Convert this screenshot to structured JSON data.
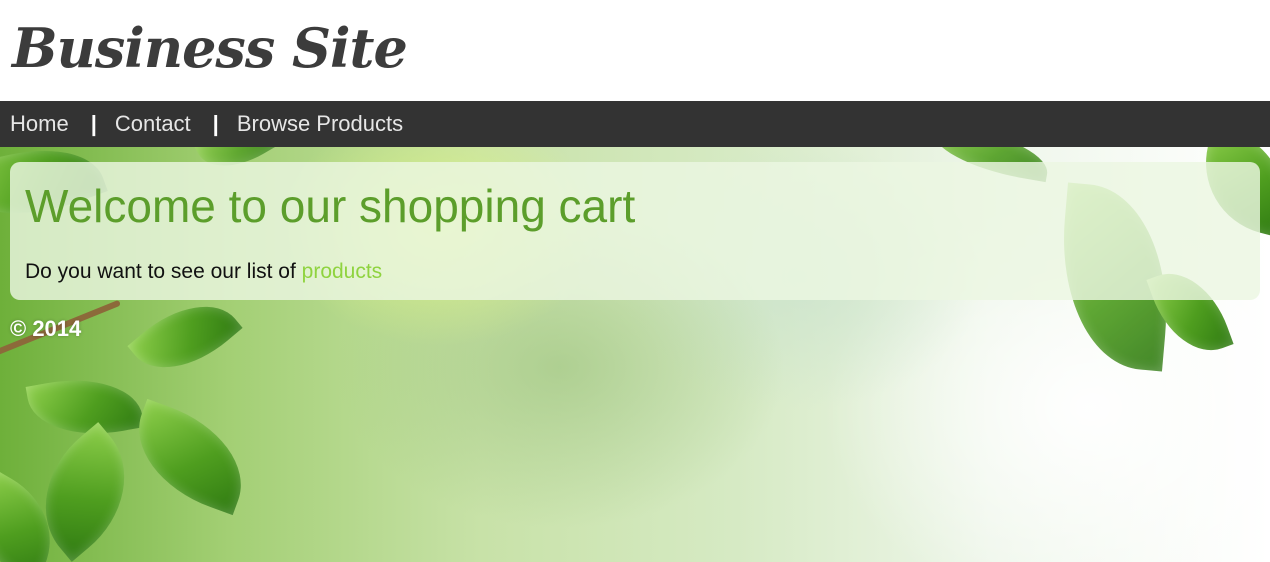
{
  "header": {
    "site_title": "Business Site"
  },
  "nav": {
    "items": [
      {
        "label": "Home"
      },
      {
        "label": "Contact"
      },
      {
        "label": "Browse Products"
      }
    ],
    "separator": "|"
  },
  "main": {
    "heading": "Welcome to our shopping cart",
    "intro_text": "Do you want to see our list of ",
    "products_link": "products"
  },
  "footer": {
    "copyright": "© 2014"
  },
  "colors": {
    "nav_background": "#333333",
    "heading_green": "#5c9e2b",
    "link_green": "#8fd33f",
    "title_text": "#3c3c3c"
  }
}
